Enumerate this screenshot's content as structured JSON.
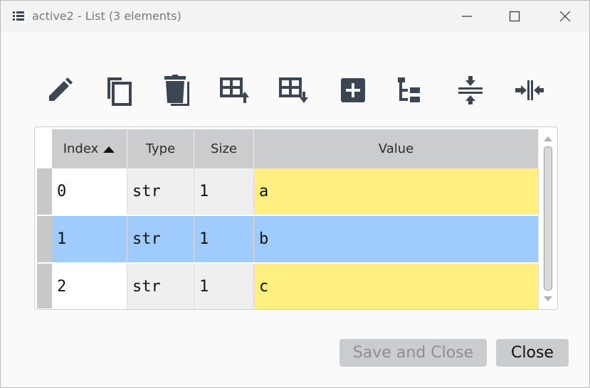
{
  "window": {
    "title": "active2 - List (3 elements)",
    "controls": [
      "minimize-icon",
      "maximize-icon",
      "close-icon"
    ]
  },
  "toolbar": {
    "icons": [
      "edit-icon",
      "copy-icon",
      "paste-icon",
      "insert-above-icon",
      "insert-below-icon",
      "add-icon",
      "tree-view-icon",
      "collapse-icon",
      "expand-icon"
    ],
    "color": "#3c4652"
  },
  "table": {
    "columns": [
      "Index",
      "Type",
      "Size",
      "Value"
    ],
    "sort_column": "Index",
    "sort_direction": "ascending",
    "rows": [
      {
        "index": "0",
        "type": "str",
        "size": "1",
        "value": "a"
      },
      {
        "index": "1",
        "type": "str",
        "size": "1",
        "value": "b"
      },
      {
        "index": "2",
        "type": "str",
        "size": "1",
        "value": "c"
      }
    ],
    "selected_row": 1,
    "colors": {
      "header": "#cbcccd",
      "value_cell": "#fff081",
      "selected": "#9fcbfd",
      "index_cell": "#ffffff",
      "other_cell": "#efefef"
    }
  },
  "buttons": {
    "save_label": "Save and Close",
    "close_label": "Close"
  }
}
